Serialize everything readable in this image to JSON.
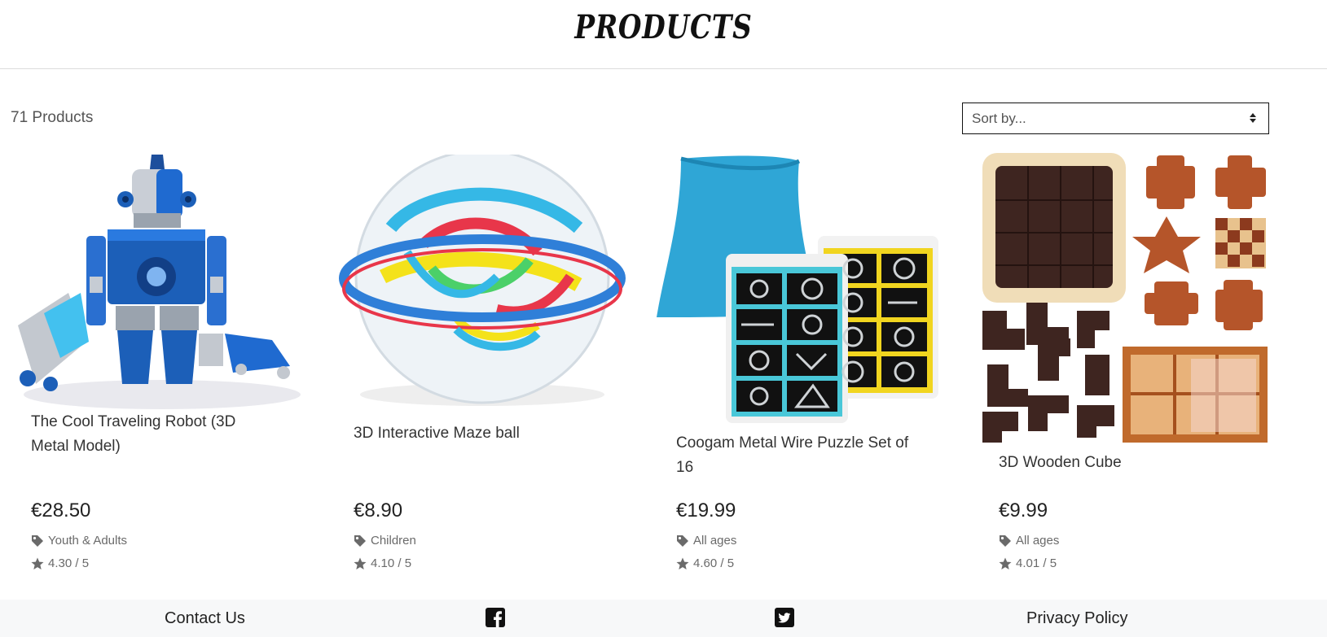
{
  "header": {
    "title": "PRODUCTS"
  },
  "toolbar": {
    "product_count": "71 Products",
    "sort_placeholder": "Sort by..."
  },
  "products": [
    {
      "name": "The Cool Traveling Robot (3D Metal Model)",
      "price": "€28.50",
      "age_group": "Youth & Adults",
      "rating": "4.30 / 5",
      "image": "robot-model-image"
    },
    {
      "name": "3D Interactive Maze ball",
      "price": "€8.90",
      "age_group": "Children",
      "rating": "4.10 / 5",
      "image": "maze-ball-image"
    },
    {
      "name": "Coogam Metal Wire Puzzle Set of 16",
      "price": "€19.99",
      "age_group": "All ages",
      "rating": "4.60 / 5",
      "image": "wire-puzzle-image"
    },
    {
      "name": "3D Wooden Cube",
      "price": "€9.99",
      "age_group": "All ages",
      "rating": "4.01 / 5",
      "image": "wooden-cube-image"
    }
  ],
  "footer": {
    "contact": "Contact Us",
    "facebook_icon": "facebook-icon",
    "twitter_icon": "twitter-icon",
    "privacy": "Privacy Policy"
  },
  "colors": {
    "footer_bg": "#f7f8f9",
    "meta_text": "#6a6a6a",
    "robot_blue": "#1c5fb8",
    "maze_blue": "#2f7fd8",
    "bag_teal": "#2fa6d6",
    "card_teal": "#49c7d8",
    "card_yellow": "#f1d51f",
    "wood_dark": "#3e2520",
    "wood_light": "#b5552a"
  }
}
